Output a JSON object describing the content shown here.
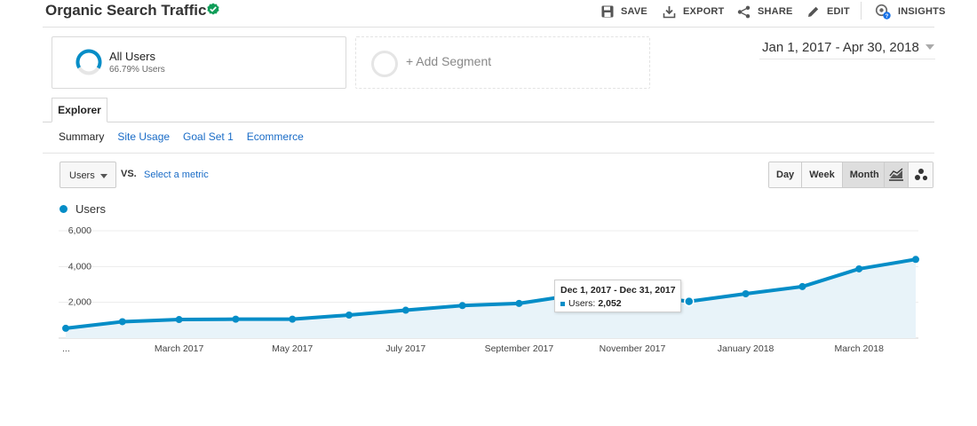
{
  "header": {
    "title": "Organic Search Traffic",
    "tools": {
      "save": "SAVE",
      "export": "EXPORT",
      "share": "SHARE",
      "edit": "EDIT",
      "insights": "INSIGHTS"
    }
  },
  "segments": {
    "active": {
      "name": "All Users",
      "share": "66.79% Users"
    },
    "add_label": "+ Add Segment"
  },
  "date_range": "Jan 1, 2017 - Apr 30, 2018",
  "tabs": {
    "explorer": "Explorer"
  },
  "subnav": [
    "Summary",
    "Site Usage",
    "Goal Set 1",
    "Ecommerce"
  ],
  "controls": {
    "metric": "Users",
    "vs": "VS.",
    "select_metric": "Select a metric",
    "periods": [
      "Day",
      "Week",
      "Month"
    ],
    "active_period": "Month"
  },
  "colors": {
    "series": "#058dc7",
    "verified": "#0f9d58",
    "link": "#1a6cc7"
  },
  "chart_data": {
    "type": "area",
    "series": [
      {
        "name": "Users",
        "x": [
          "Jan 2017",
          "Feb 2017",
          "Mar 2017",
          "Apr 2017",
          "May 2017",
          "Jun 2017",
          "Jul 2017",
          "Aug 2017",
          "Sep 2017",
          "Oct 2017",
          "Nov 2017",
          "Dec 2017",
          "Jan 2018",
          "Feb 2018",
          "Mar 2018",
          "Apr 2018"
        ],
        "values": [
          550,
          920,
          1040,
          1060,
          1060,
          1290,
          1560,
          1820,
          1940,
          2420,
          2440,
          2052,
          2480,
          2880,
          3870,
          4400
        ]
      }
    ],
    "y_ticks": [
      "2,000",
      "4,000",
      "6,000"
    ],
    "x_tick_labels": [
      "...",
      "March 2017",
      "May 2017",
      "July 2017",
      "September 2017",
      "November 2017",
      "January 2018",
      "March 2018"
    ],
    "ylim": [
      0,
      6000
    ],
    "tooltip": {
      "title": "Dec 1, 2017 - Dec 31, 2017",
      "label": "Users:",
      "value": "2,052",
      "index": 11
    },
    "legend": "Users",
    "grid": true
  }
}
